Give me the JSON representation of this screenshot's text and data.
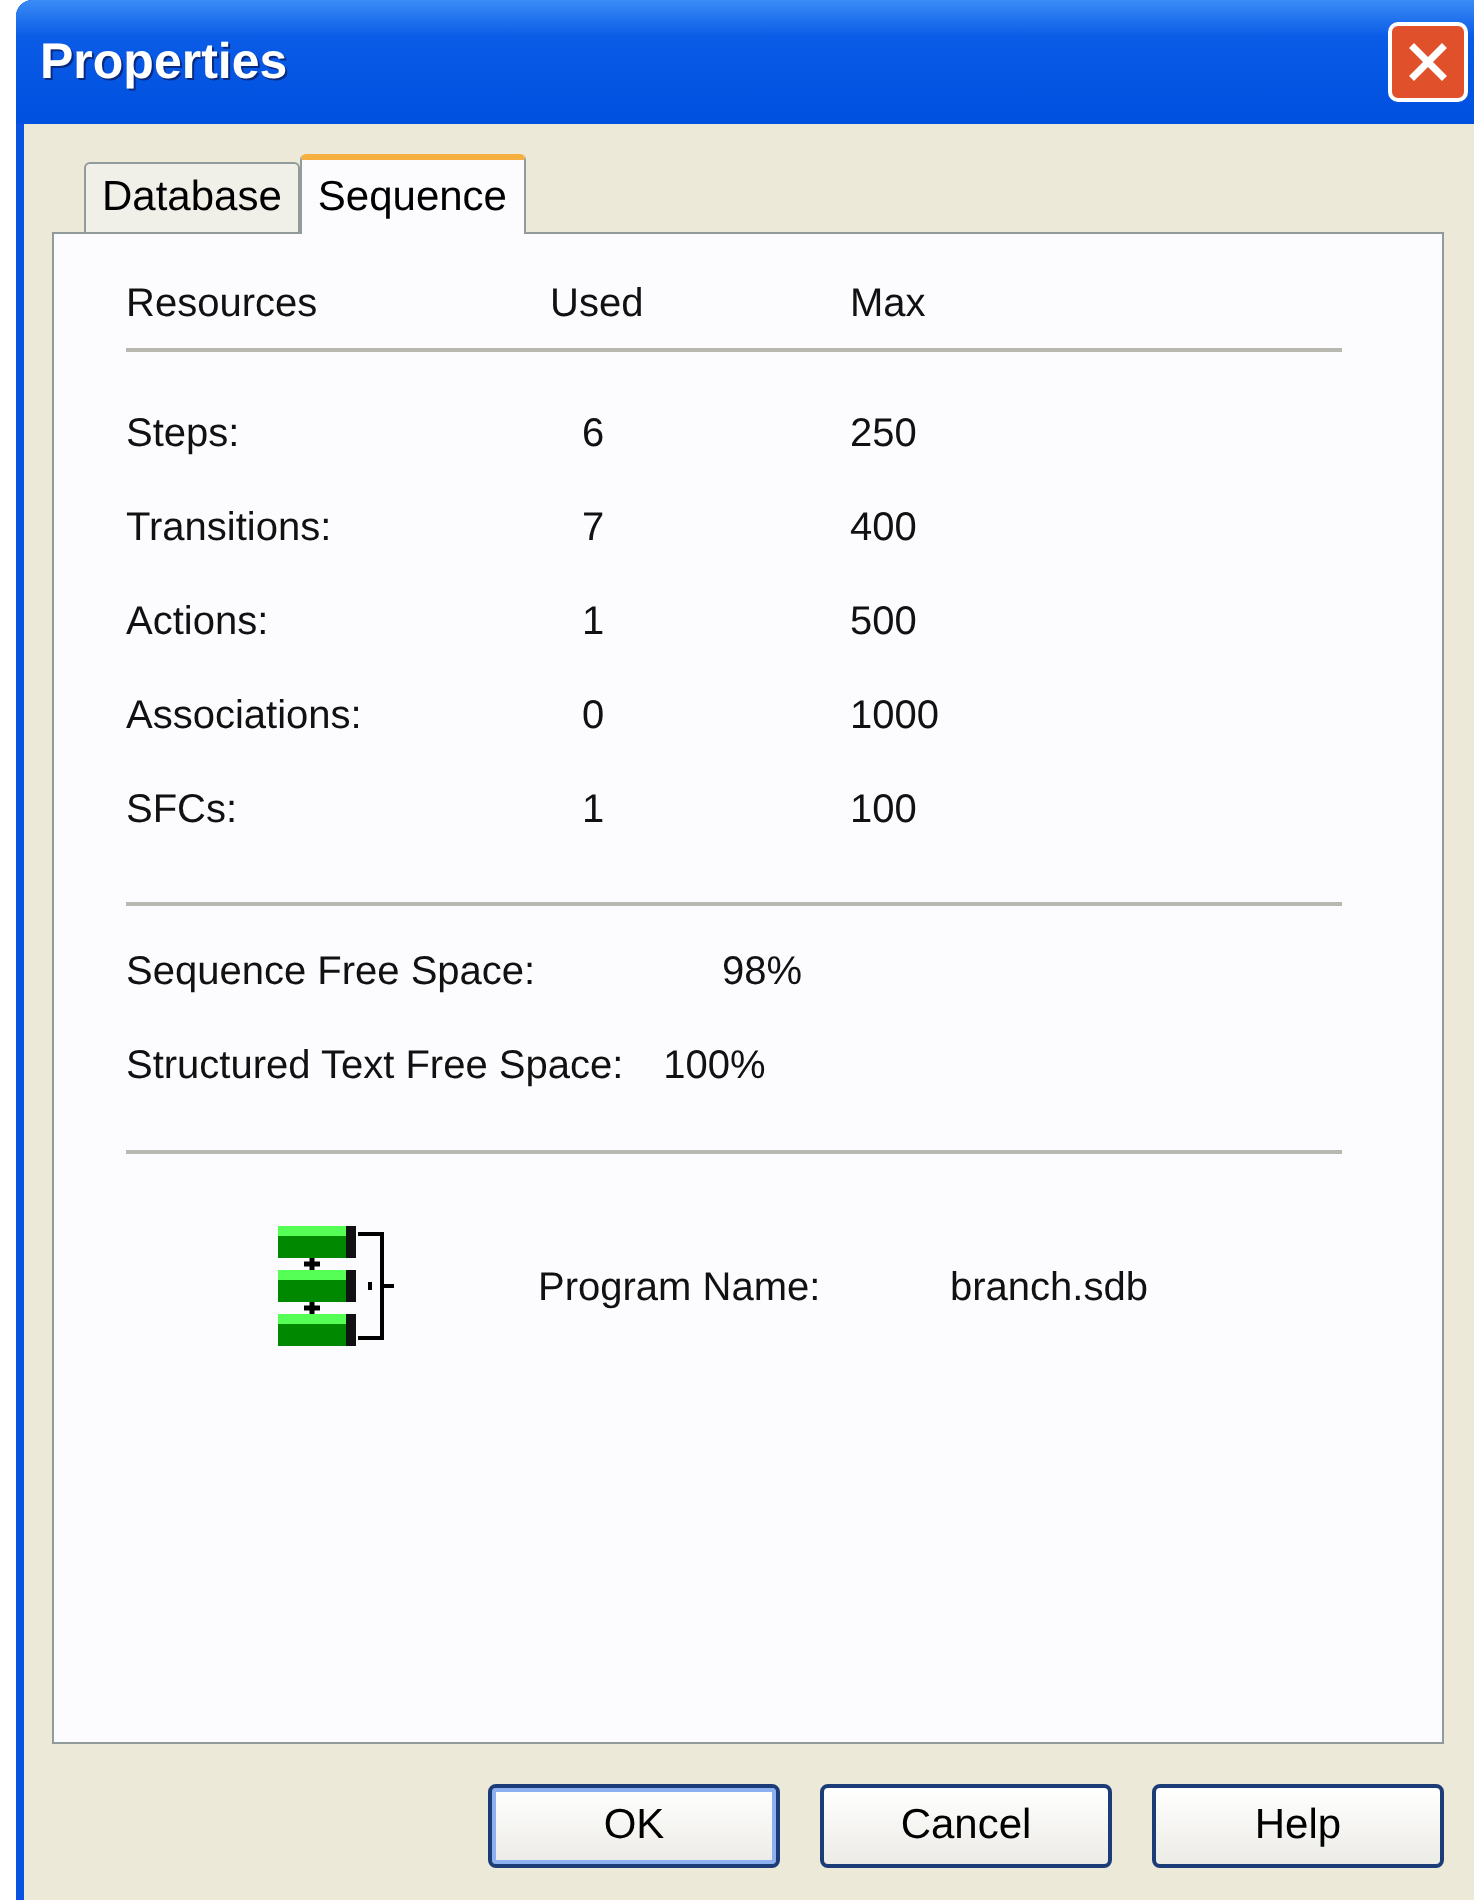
{
  "window": {
    "title": "Properties"
  },
  "tabs": [
    {
      "label": "Database",
      "selected": false
    },
    {
      "label": "Sequence",
      "selected": true
    }
  ],
  "resources": {
    "columns": [
      "Resources",
      "Used",
      "Max"
    ],
    "rows": [
      {
        "name": "Steps:",
        "used": "6",
        "max": "250"
      },
      {
        "name": "Transitions:",
        "used": "7",
        "max": "400"
      },
      {
        "name": "Actions:",
        "used": "1",
        "max": "500"
      },
      {
        "name": "Associations:",
        "used": "0",
        "max": "1000"
      },
      {
        "name": "SFCs:",
        "used": "1",
        "max": "100"
      }
    ]
  },
  "free_space": [
    {
      "label": "Sequence Free Space:",
      "value": "98%"
    },
    {
      "label": "Structured Text Free Space:",
      "value": "100%"
    }
  ],
  "program": {
    "label": "Program Name:",
    "value": "branch.sdb"
  },
  "buttons": [
    {
      "label": "OK",
      "default": true
    },
    {
      "label": "Cancel",
      "default": false
    },
    {
      "label": "Help",
      "default": false
    }
  ]
}
